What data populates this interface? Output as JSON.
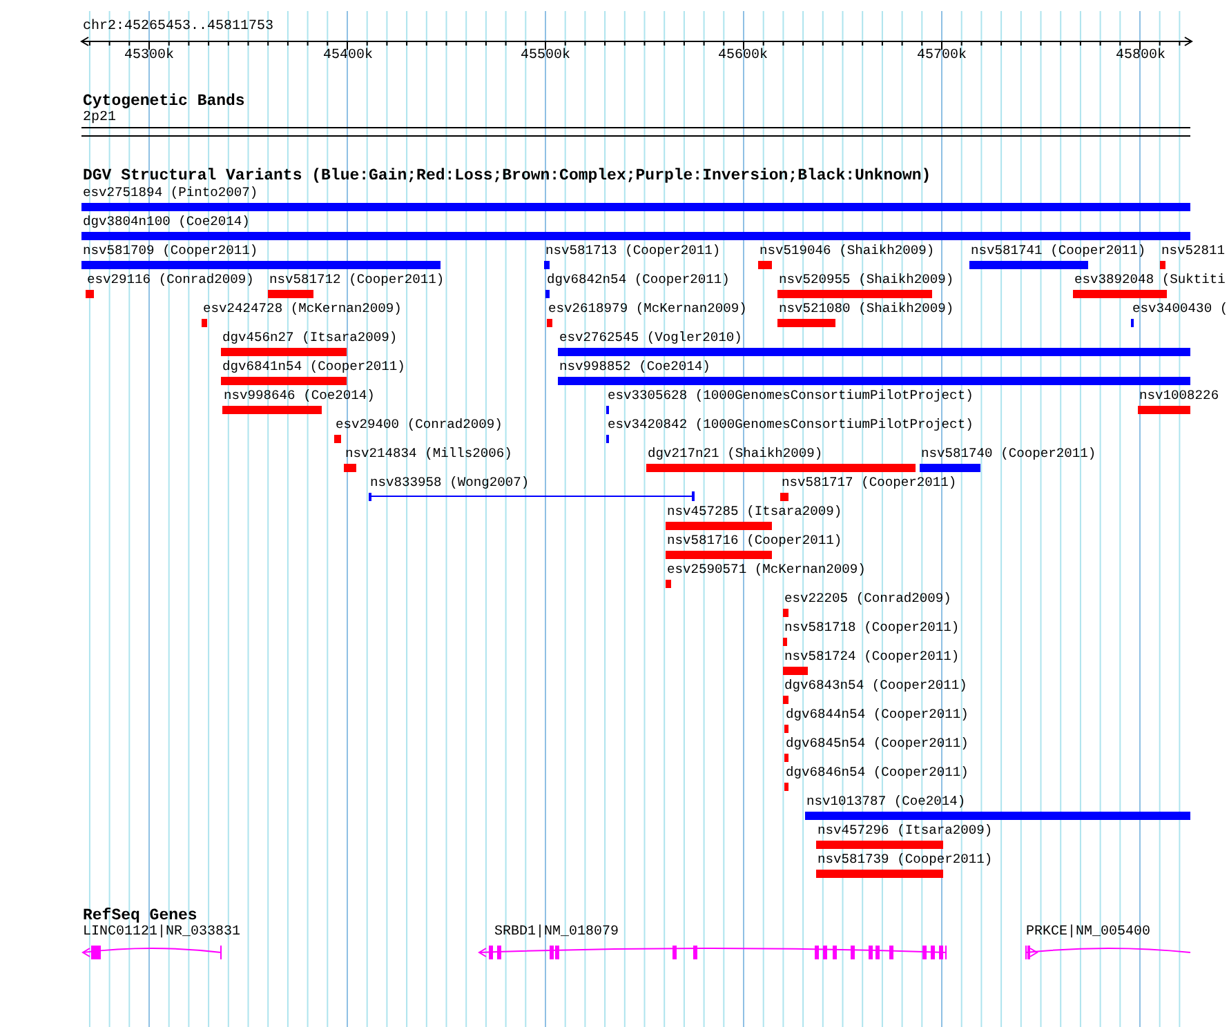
{
  "ruler": {
    "location": "chr2:45265453..45811753",
    "ticks": [
      "45300k",
      "45400k",
      "45500k",
      "45600k",
      "45700k",
      "45800k"
    ]
  },
  "cytogenetic_bands": {
    "title": "Cytogenetic Bands",
    "band": "2p21"
  },
  "dgv": {
    "title": "DGV Structural Variants (Blue:Gain;Red:Loss;Brown:Complex;Purple:Inversion;Black:Unknown)",
    "variants": [
      {
        "label": "esv2751894 (Pinto2007)",
        "kind": "bar",
        "color": "#0000ff"
      },
      {
        "label": "dgv3804n100 (Coe2014)",
        "kind": "bar",
        "color": "#0000ff"
      },
      {
        "label": "nsv581709 (Cooper2011)",
        "kind": "bar",
        "color": "#0000ff"
      },
      {
        "label": "nsv581713 (Cooper2011)",
        "kind": "bar",
        "color": "#0000ff"
      },
      {
        "label": "nsv519046 (Shaikh2009)",
        "kind": "bar",
        "color": "#ff0000"
      },
      {
        "label": "nsv581741 (Cooper2011)",
        "kind": "bar",
        "color": "#0000ff"
      },
      {
        "label": "nsv52811",
        "kind": "bar",
        "color": "#ff0000"
      },
      {
        "label": "esv29116 (Conrad2009)",
        "kind": "bar",
        "color": "#ff0000"
      },
      {
        "label": "nsv581712 (Cooper2011)",
        "kind": "bar",
        "color": "#ff0000"
      },
      {
        "label": "dgv6842n54 (Cooper2011)",
        "kind": "bar",
        "color": "#0000ff"
      },
      {
        "label": "nsv520955 (Shaikh2009)",
        "kind": "bar",
        "color": "#ff0000"
      },
      {
        "label": "esv3892048 (Suktiti",
        "kind": "bar",
        "color": "#ff0000"
      },
      {
        "label": "esv2424728 (McKernan2009)",
        "kind": "bar",
        "color": "#ff0000"
      },
      {
        "label": "esv2618979 (McKernan2009)",
        "kind": "bar",
        "color": "#ff0000"
      },
      {
        "label": "nsv521080 (Shaikh2009)",
        "kind": "bar",
        "color": "#ff0000"
      },
      {
        "label": "esv3400430 (",
        "kind": "bar",
        "color": "#0000ff"
      },
      {
        "label": "dgv456n27 (Itsara2009)",
        "kind": "bar",
        "color": "#ff0000"
      },
      {
        "label": "esv2762545 (Vogler2010)",
        "kind": "bar",
        "color": "#0000ff"
      },
      {
        "label": "dgv6841n54 (Cooper2011)",
        "kind": "bar",
        "color": "#ff0000"
      },
      {
        "label": "nsv998852 (Coe2014)",
        "kind": "bar",
        "color": "#0000ff"
      },
      {
        "label": "nsv998646 (Coe2014)",
        "kind": "bar",
        "color": "#ff0000"
      },
      {
        "label": "esv3305628 (1000GenomesConsortiumPilotProject)",
        "kind": "bar",
        "color": "#0000ff"
      },
      {
        "label": "nsv1008226",
        "kind": "bar",
        "color": "#ff0000"
      },
      {
        "label": "esv29400 (Conrad2009)",
        "kind": "bar",
        "color": "#ff0000"
      },
      {
        "label": "esv3420842 (1000GenomesConsortiumPilotProject)",
        "kind": "bar",
        "color": "#0000ff"
      },
      {
        "label": "nsv214834 (Mills2006)",
        "kind": "bar",
        "color": "#ff0000"
      },
      {
        "label": "dgv217n21 (Shaikh2009)",
        "kind": "bar",
        "color": "#ff0000"
      },
      {
        "label": "nsv581740 (Cooper2011)",
        "kind": "bar",
        "color": "#0000ff"
      },
      {
        "label": "nsv833958 (Wong2007)",
        "kind": "span",
        "color": "#0000ff"
      },
      {
        "label": "nsv581717 (Cooper2011)",
        "kind": "bar",
        "color": "#ff0000"
      },
      {
        "label": "nsv457285 (Itsara2009)",
        "kind": "bar",
        "color": "#ff0000"
      },
      {
        "label": "nsv581716 (Cooper2011)",
        "kind": "bar",
        "color": "#ff0000"
      },
      {
        "label": "esv2590571 (McKernan2009)",
        "kind": "bar",
        "color": "#ff0000"
      },
      {
        "label": "esv22205 (Conrad2009)",
        "kind": "bar",
        "color": "#ff0000"
      },
      {
        "label": "nsv581718 (Cooper2011)",
        "kind": "bar",
        "color": "#ff0000"
      },
      {
        "label": "nsv581724 (Cooper2011)",
        "kind": "bar",
        "color": "#ff0000"
      },
      {
        "label": "dgv6843n54 (Cooper2011)",
        "kind": "bar",
        "color": "#ff0000"
      },
      {
        "label": "dgv6844n54 (Cooper2011)",
        "kind": "bar",
        "color": "#ff0000"
      },
      {
        "label": "dgv6845n54 (Cooper2011)",
        "kind": "bar",
        "color": "#ff0000"
      },
      {
        "label": "dgv6846n54 (Cooper2011)",
        "kind": "bar",
        "color": "#ff0000"
      },
      {
        "label": "nsv1013787 (Coe2014)",
        "kind": "bar",
        "color": "#0000ff"
      },
      {
        "label": "nsv457296 (Itsara2009)",
        "kind": "bar",
        "color": "#ff0000"
      },
      {
        "label": "nsv581739 (Cooper2011)",
        "kind": "bar",
        "color": "#ff0000"
      }
    ]
  },
  "refseq": {
    "title": "RefSeq Genes",
    "genes": [
      {
        "label": "LINC01121|NR_033831"
      },
      {
        "label": "SRBD1|NM_018079"
      },
      {
        "label": "PRKCE|NM_005400"
      }
    ]
  }
}
